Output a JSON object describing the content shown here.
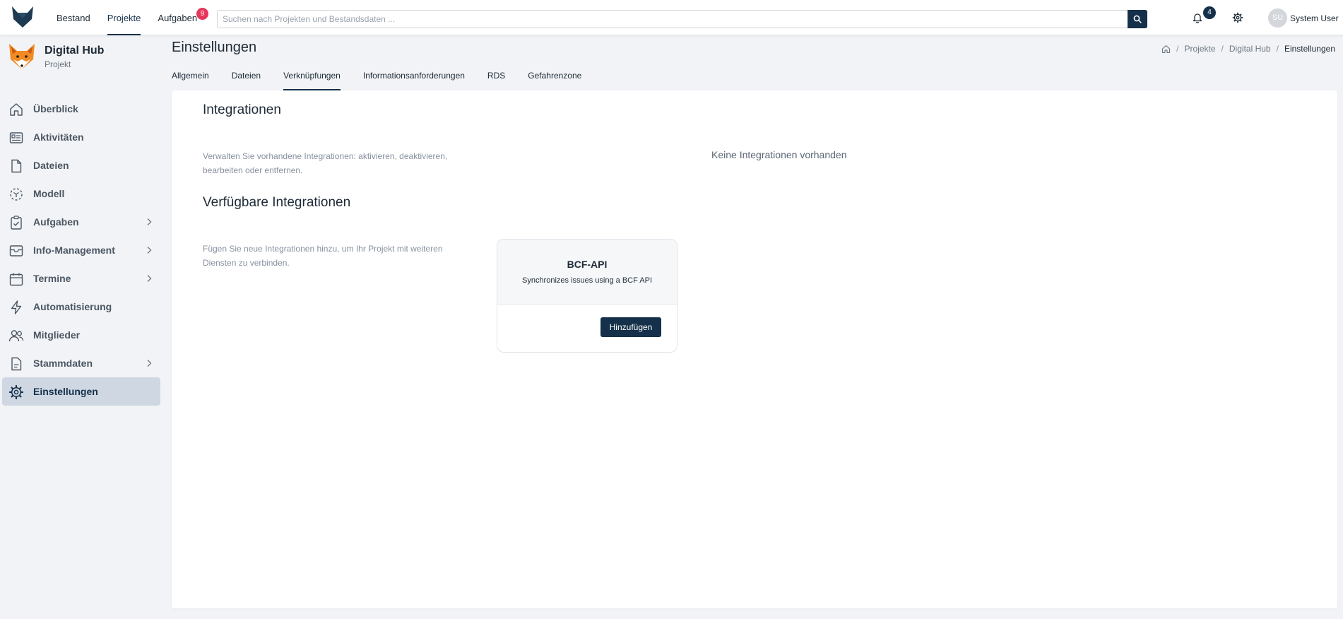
{
  "topbar": {
    "nav": [
      {
        "label": "Bestand",
        "active": false
      },
      {
        "label": "Projekte",
        "active": true
      },
      {
        "label": "Aufgaben",
        "active": false,
        "badge": "9"
      }
    ],
    "search": {
      "placeholder": "Suchen nach Projekten und Bestandsdaten ..."
    },
    "notifications_count": "4",
    "user": {
      "initials": "SU",
      "name": "System User"
    }
  },
  "sidebar": {
    "project_name": "Digital Hub",
    "project_type": "Projekt",
    "items": [
      {
        "label": "Überblick",
        "icon": "home-icon",
        "has_children": false
      },
      {
        "label": "Aktivitäten",
        "icon": "activity-feed-icon",
        "has_children": false
      },
      {
        "label": "Dateien",
        "icon": "file-icon",
        "has_children": false
      },
      {
        "label": "Modell",
        "icon": "model-cube-icon",
        "has_children": false
      },
      {
        "label": "Aufgaben",
        "icon": "task-clipboard-icon",
        "has_children": true
      },
      {
        "label": "Info-Management",
        "icon": "inbox-icon",
        "has_children": true
      },
      {
        "label": "Termine",
        "icon": "calendar-icon",
        "has_children": true
      },
      {
        "label": "Automatisierung",
        "icon": "lightning-icon",
        "has_children": false
      },
      {
        "label": "Mitglieder",
        "icon": "users-icon",
        "has_children": false
      },
      {
        "label": "Stammdaten",
        "icon": "document-icon",
        "has_children": true
      },
      {
        "label": "Einstellungen",
        "icon": "gear-icon",
        "has_children": false,
        "active": true
      }
    ]
  },
  "page": {
    "title": "Einstellungen",
    "breadcrumb": [
      "Projekte",
      "Digital Hub",
      "Einstellungen"
    ],
    "tabs": [
      {
        "label": "Allgemein",
        "active": false
      },
      {
        "label": "Dateien",
        "active": false
      },
      {
        "label": "Verknüpfungen",
        "active": true
      },
      {
        "label": "Informationsanforderungen",
        "active": false
      },
      {
        "label": "RDS",
        "active": false
      },
      {
        "label": "Gefahrenzone",
        "active": false
      }
    ]
  },
  "integrations": {
    "title": "Integrationen",
    "description": "Verwalten Sie vorhandene Integrationen: aktivieren, deaktivieren, bearbeiten oder entfernen.",
    "empty_text": "Keine Integrationen vorhanden"
  },
  "available": {
    "title": "Verfügbare Integrationen",
    "description": "Fügen Sie neue Integrationen hinzu, um Ihr Projekt mit weiteren Diensten zu verbinden.",
    "items": [
      {
        "name": "BCF-API",
        "description": "Synchronizes issues using a BCF API",
        "button_label": "Hinzufügen"
      }
    ]
  },
  "colors": {
    "primary": "#15304a",
    "badge_red": "#e8365a",
    "sidebar_active": "#cfd7e2",
    "background": "#f1f3f6"
  }
}
